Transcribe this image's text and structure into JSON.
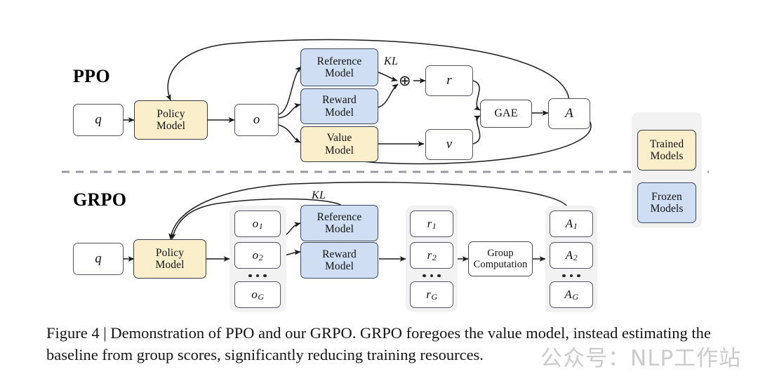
{
  "figure": {
    "caption": "Figure 4 | Demonstration of PPO and our GRPO. GRPO foregoes the value model, instead estimating the baseline from group scores, significantly reducing training resources.",
    "watermark": "公众号：NLP工作站"
  },
  "colors": {
    "trained_fill": "#fbeecb",
    "frozen_fill": "#cfdef2",
    "group_fill": "#f2f2f2",
    "stroke": "#3a3a42",
    "divider": "#9a9aa0"
  },
  "ppo": {
    "title": "PPO",
    "query": "q",
    "policy_model": "Policy Model",
    "output": "o",
    "reference_model": "Reference Model",
    "reward_model": "Reward Model",
    "value_model": "Value Model",
    "kl_label": "KL",
    "plus_operator": "⊕",
    "reward": "r",
    "value": "v",
    "gae": "GAE",
    "advantage": "A"
  },
  "grpo": {
    "title": "GRPO",
    "query": "q",
    "policy_model": "Policy Model",
    "kl_label": "KL",
    "reference_model": "Reference Model",
    "reward_model": "Reward Model",
    "group_computation": "Group Computation",
    "outputs": [
      {
        "base": "o",
        "sub": "1"
      },
      {
        "base": "o",
        "sub": "2"
      },
      {
        "base": "o",
        "sub": "G"
      }
    ],
    "rewards": [
      {
        "base": "r",
        "sub": "1"
      },
      {
        "base": "r",
        "sub": "2"
      },
      {
        "base": "r",
        "sub": "G"
      }
    ],
    "advantages": [
      {
        "base": "A",
        "sub": "1"
      },
      {
        "base": "A",
        "sub": "2"
      },
      {
        "base": "A",
        "sub": "G"
      }
    ]
  },
  "legend": {
    "trained": "Trained Models",
    "frozen": "Frozen Models"
  }
}
